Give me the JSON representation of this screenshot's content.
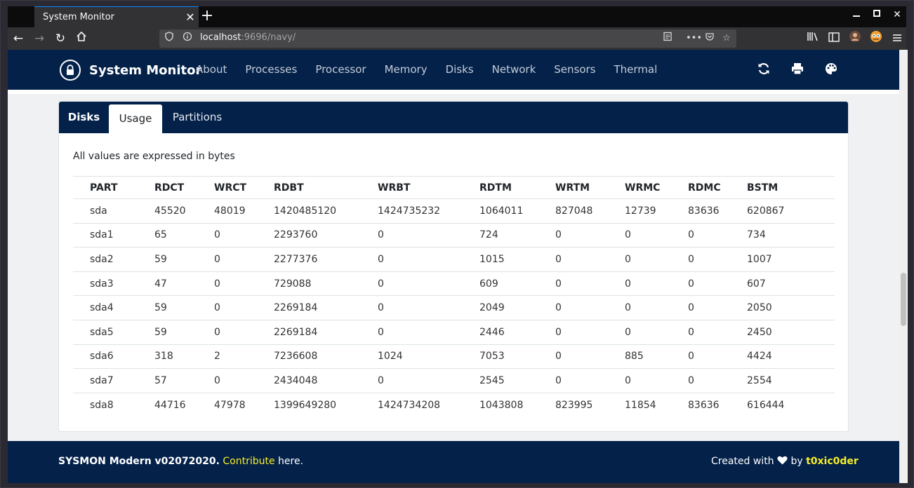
{
  "browser": {
    "tab_title": "System Monitor",
    "url_host": "localhost",
    "url_rest": ":9696/navy/",
    "icons": [
      "back-icon",
      "forward-icon",
      "reload-icon",
      "home-icon",
      "shield-icon",
      "info-icon",
      "reader-icon",
      "more-icon",
      "pocket-icon",
      "star-icon",
      "library-icon",
      "sidebar-icon",
      "account-icon",
      "extension-icon",
      "menu-icon"
    ]
  },
  "app": {
    "brand": "System Monitor",
    "nav": [
      "About",
      "Processes",
      "Processor",
      "Memory",
      "Disks",
      "Network",
      "Sensors",
      "Thermal"
    ],
    "actions": [
      "refresh-icon",
      "print-icon",
      "palette-icon"
    ]
  },
  "card": {
    "title_tab": "Disks",
    "tabs": [
      "Usage",
      "Partitions"
    ],
    "active_tab": "Usage",
    "note": "All values are expressed in bytes",
    "columns": [
      "PART",
      "RDCT",
      "WRCT",
      "RDBT",
      "WRBT",
      "RDTM",
      "WRTM",
      "WRMC",
      "RDMC",
      "BSTM"
    ],
    "rows": [
      [
        "sda",
        "45520",
        "48019",
        "1420485120",
        "1424735232",
        "1064011",
        "827048",
        "12739",
        "83636",
        "620867"
      ],
      [
        "sda1",
        "65",
        "0",
        "2293760",
        "0",
        "724",
        "0",
        "0",
        "0",
        "734"
      ],
      [
        "sda2",
        "59",
        "0",
        "2277376",
        "0",
        "1015",
        "0",
        "0",
        "0",
        "1007"
      ],
      [
        "sda3",
        "47",
        "0",
        "729088",
        "0",
        "609",
        "0",
        "0",
        "0",
        "607"
      ],
      [
        "sda4",
        "59",
        "0",
        "2269184",
        "0",
        "2049",
        "0",
        "0",
        "0",
        "2050"
      ],
      [
        "sda5",
        "59",
        "0",
        "2269184",
        "0",
        "2446",
        "0",
        "0",
        "0",
        "2450"
      ],
      [
        "sda6",
        "318",
        "2",
        "7236608",
        "1024",
        "7053",
        "0",
        "885",
        "0",
        "4424"
      ],
      [
        "sda7",
        "57",
        "0",
        "2434048",
        "0",
        "2545",
        "0",
        "0",
        "0",
        "2554"
      ],
      [
        "sda8",
        "44716",
        "47978",
        "1399649280",
        "1424734208",
        "1043808",
        "823995",
        "11854",
        "83636",
        "616444"
      ]
    ]
  },
  "footer": {
    "version": "SYSMON Modern v02072020.",
    "contribute": "Contribute",
    "here": " here.",
    "created": "Created with",
    "by": "by",
    "author": "t0xic0der"
  },
  "colors": {
    "navy": "#032149",
    "accent_yellow": "#f8ed2a"
  }
}
